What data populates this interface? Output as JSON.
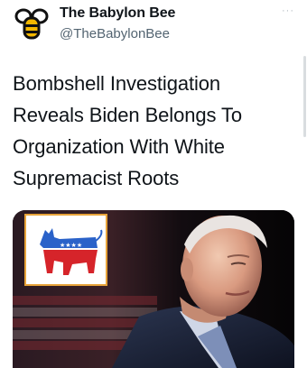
{
  "author": {
    "name": "The Babylon Bee",
    "handle": "@TheBabylonBee",
    "avatar_icon": "bee-logo-icon"
  },
  "more_options": "···",
  "tweet": {
    "text": "Bombshell Investigation Reveals Biden Belongs To Organization With White Supremacist Roots"
  },
  "media": {
    "inset_icon": "democratic-donkey-logo-icon",
    "inset_border_color": "#e7a33a",
    "donkey_colors": {
      "blue": "#2a62c9",
      "red": "#d6242a"
    }
  }
}
